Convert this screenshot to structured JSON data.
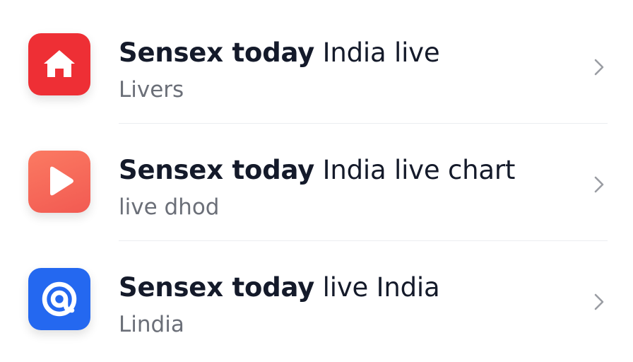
{
  "items": [
    {
      "title_bold": "Sensex today",
      "title_rest": "India live",
      "subtitle": "Livers",
      "icon": "home-icon",
      "icon_color": "#ee2f35"
    },
    {
      "title_bold": "Sensex today",
      "title_rest": "India live chart",
      "subtitle": "live dhod",
      "icon": "play-icon",
      "icon_color": "#f8685a"
    },
    {
      "title_bold": "Sensex today",
      "title_rest": "live India",
      "subtitle": "Lindia",
      "icon": "at-sign-icon",
      "icon_color": "#2468f0"
    }
  ],
  "colors": {
    "title": "#141a2a",
    "subtitle": "#6b6f78",
    "chevron": "#9a9da3",
    "divider": "#ebedf0"
  }
}
